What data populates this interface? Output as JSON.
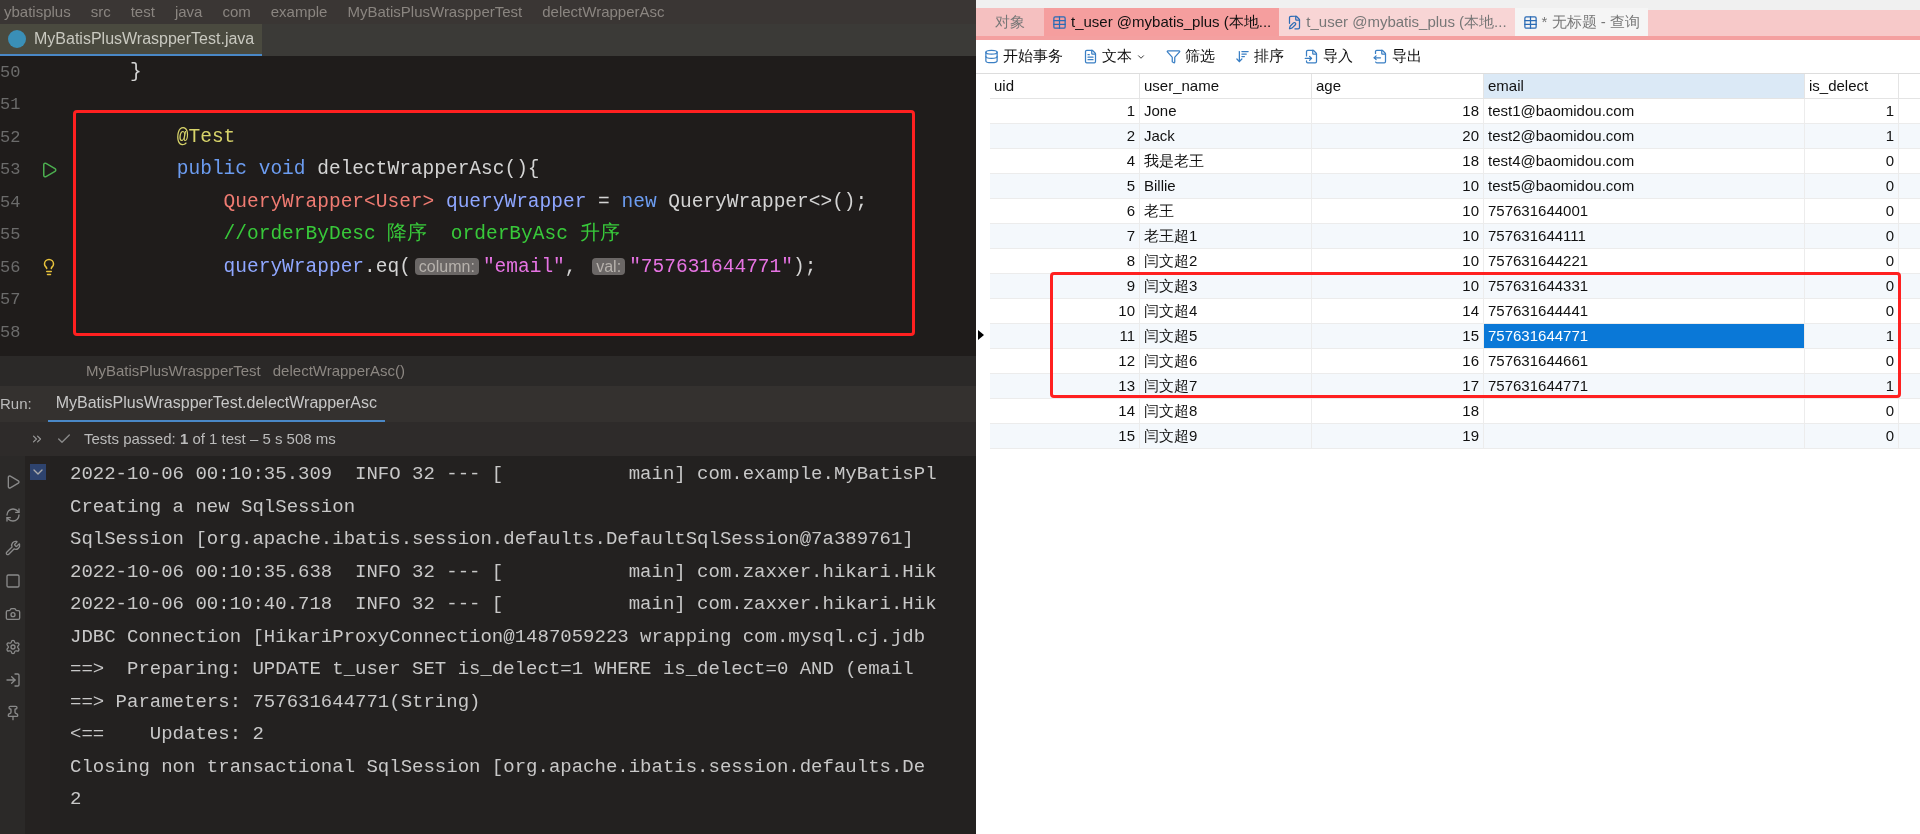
{
  "ide": {
    "breadcrumbs": [
      "ybatisplus",
      "src",
      "test",
      "java",
      "com",
      "example",
      "MyBatisPlusWraspperTest",
      "delectWrapperAsc"
    ],
    "editor_tab": {
      "label": "MyBatisPlusWraspperTest.java",
      "selected": true
    },
    "code_lines": [
      {
        "number": "50",
        "kind": "plain",
        "tokens": [
          {
            "kind": "plain",
            "text": "}"
          }
        ]
      },
      {
        "number": "51",
        "kind": "plain"
      },
      {
        "number": "52",
        "kind": "plain",
        "tokens": [
          {
            "kind": "annotation",
            "text": "    @Test"
          }
        ]
      },
      {
        "number": "53",
        "kind": "run",
        "tokens": [
          {
            "kind": "keyword",
            "text": "    public void "
          },
          {
            "kind": "plain",
            "text": "delectWrapperAsc(){"
          }
        ]
      },
      {
        "number": "54",
        "kind": "plain",
        "tokens": [
          {
            "kind": "type",
            "text": "        QueryWrapper<User> "
          },
          {
            "kind": "ident",
            "text": "queryWrapper"
          },
          {
            "kind": "plain",
            "text": " = "
          },
          {
            "kind": "keyword",
            "text": "new "
          },
          {
            "kind": "plain",
            "text": "QueryWrapper<>();"
          }
        ]
      },
      {
        "number": "55",
        "kind": "plain",
        "tokens": [
          {
            "kind": "comment",
            "text": "        //orderByDesc 降序  orderByAsc 升序"
          }
        ]
      },
      {
        "number": "56",
        "kind": "bulb",
        "tokens": [
          {
            "kind": "ident",
            "text": "        queryWrapper"
          },
          {
            "kind": "plain",
            "text": ".eq("
          },
          {
            "kind": "hint",
            "text": "column:"
          },
          {
            "kind": "string",
            "text": "\"email\""
          },
          {
            "kind": "plain",
            "text": ", "
          },
          {
            "kind": "hint",
            "text": "val:"
          },
          {
            "kind": "string",
            "text": "\"757631644771\""
          },
          {
            "kind": "plain",
            "text": ");"
          }
        ]
      },
      {
        "number": "57",
        "kind": "plain"
      },
      {
        "number": "58",
        "kind": "plain"
      }
    ],
    "editor_breadcrumbs": [
      "MyBatisPlusWraspperTest",
      "delectWrapperAsc()"
    ],
    "run": {
      "label": "Run:",
      "tab": {
        "label": "MyBatisPlusWraspperTest.delectWrapperAsc",
        "selected": true
      },
      "status": "Tests passed: **1** of 1 test – 5 s 508 ms",
      "console": [
        "2022-10-06 00:10:35.309  INFO 32 --- [           main] com.example.MyBatisPl",
        "Creating a new SqlSession",
        "SqlSession [org.apache.ibatis.session.defaults.DefaultSqlSession@7a389761]",
        "2022-10-06 00:10:35.638  INFO 32 --- [           main] com.zaxxer.hikari.Hik",
        "2022-10-06 00:10:40.718  INFO 32 --- [           main] com.zaxxer.hikari.Hik",
        "JDBC Connection [HikariProxyConnection@1487059223 wrapping com.mysql.cj.jdb",
        "==>  Preparing: UPDATE t_user SET is_delect=1 WHERE is_delect=0 AND (email",
        "==> Parameters: 757631644771(String)",
        "<==    Updates: 2",
        "Closing non transactional SqlSession [org.apache.ibatis.session.defaults.De",
        "2"
      ]
    }
  },
  "navicat": {
    "tabs": [
      {
        "label": "对象",
        "kind": "plain",
        "selected": false
      },
      {
        "label": "t_user @mybatis_plus (本地...",
        "kind": "table",
        "selected": true
      },
      {
        "label": "t_user @mybatis_plus (本地...",
        "kind": "design",
        "selected": false
      },
      {
        "label": "* 无标题 - 查询",
        "kind": "query",
        "selected": false
      }
    ],
    "toolbar": [
      {
        "label": "开始事务",
        "kind": "transaction"
      },
      {
        "label": "文本",
        "kind": "text"
      },
      {
        "label": "筛选",
        "kind": "filter"
      },
      {
        "label": "排序",
        "kind": "sort"
      },
      {
        "label": "导入",
        "kind": "import"
      },
      {
        "label": "导出",
        "kind": "export"
      }
    ],
    "table": {
      "columns": [
        {
          "label": "uid",
          "selected": false
        },
        {
          "label": "user_name",
          "selected": false
        },
        {
          "label": "age",
          "selected": false
        },
        {
          "label": "email",
          "selected": true
        },
        {
          "label": "is_delect",
          "selected": false
        }
      ],
      "rows": [
        {
          "selected": false,
          "cells": [
            "1",
            "Jone",
            "18",
            "test1@baomidou.com",
            "1"
          ]
        },
        {
          "selected": false,
          "cells": [
            "2",
            "Jack",
            "20",
            "test2@baomidou.com",
            "1"
          ]
        },
        {
          "selected": false,
          "cells": [
            "4",
            "我是老王",
            "18",
            "test4@baomidou.com",
            "0"
          ]
        },
        {
          "selected": false,
          "cells": [
            "5",
            "Billie",
            "10",
            "test5@baomidou.com",
            "0"
          ]
        },
        {
          "selected": false,
          "cells": [
            "6",
            "老王",
            "10",
            "757631644001",
            "0"
          ]
        },
        {
          "selected": false,
          "cells": [
            "7",
            "老王超1",
            "10",
            "757631644111",
            "0"
          ]
        },
        {
          "selected": false,
          "cells": [
            "8",
            "闫文超2",
            "10",
            "757631644221",
            "0"
          ]
        },
        {
          "selected": false,
          "cells": [
            "9",
            "闫文超3",
            "10",
            "757631644331",
            "0"
          ]
        },
        {
          "selected": false,
          "cells": [
            "10",
            "闫文超4",
            "14",
            "757631644441",
            "0"
          ]
        },
        {
          "selected": true,
          "cells": [
            "11",
            "闫文超5",
            "15",
            "757631644771",
            "1"
          ]
        },
        {
          "selected": false,
          "cells": [
            "12",
            "闫文超6",
            "16",
            "757631644661",
            "0"
          ]
        },
        {
          "selected": false,
          "cells": [
            "13",
            "闫文超7",
            "17",
            "757631644771",
            "1"
          ]
        },
        {
          "selected": false,
          "cells": [
            "14",
            "闫文超8",
            "18",
            "",
            "0"
          ]
        },
        {
          "selected": false,
          "cells": [
            "15",
            "闫文超9",
            "19",
            "",
            "0"
          ]
        }
      ]
    }
  }
}
